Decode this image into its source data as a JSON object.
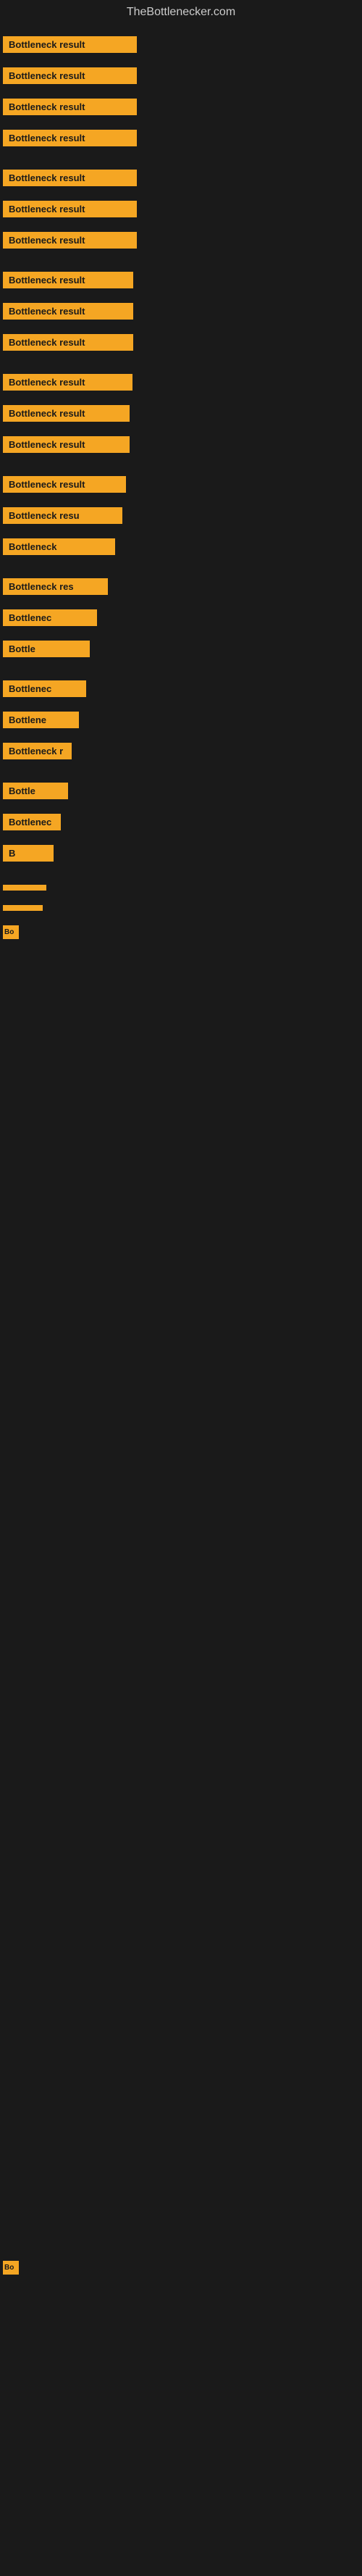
{
  "site": {
    "title": "TheBottlenecker.com"
  },
  "items": [
    {
      "id": 0,
      "label": "Bottleneck result"
    },
    {
      "id": 1,
      "label": "Bottleneck result"
    },
    {
      "id": 2,
      "label": "Bottleneck result"
    },
    {
      "id": 3,
      "label": "Bottleneck result"
    },
    {
      "id": 4,
      "label": "Bottleneck result"
    },
    {
      "id": 5,
      "label": "Bottleneck result"
    },
    {
      "id": 6,
      "label": "Bottleneck result"
    },
    {
      "id": 7,
      "label": "Bottleneck result"
    },
    {
      "id": 8,
      "label": "Bottleneck result"
    },
    {
      "id": 9,
      "label": "Bottleneck result"
    },
    {
      "id": 10,
      "label": "Bottleneck result"
    },
    {
      "id": 11,
      "label": "Bottleneck result"
    },
    {
      "id": 12,
      "label": "Bottleneck result"
    },
    {
      "id": 13,
      "label": "Bottleneck result"
    },
    {
      "id": 14,
      "label": "Bottleneck resu"
    },
    {
      "id": 15,
      "label": "Bottleneck"
    },
    {
      "id": 16,
      "label": "Bottleneck res"
    },
    {
      "id": 17,
      "label": "Bottlenec"
    },
    {
      "id": 18,
      "label": "Bottle"
    },
    {
      "id": 19,
      "label": "Bottlenec"
    },
    {
      "id": 20,
      "label": "Bottlene"
    },
    {
      "id": 21,
      "label": "Bottleneck r"
    },
    {
      "id": 22,
      "label": "Bottle"
    },
    {
      "id": 23,
      "label": "Bottlenec"
    },
    {
      "id": 24,
      "label": "B"
    },
    {
      "id": 25,
      "label": ""
    },
    {
      "id": 26,
      "label": ""
    },
    {
      "id": 27,
      "label": "Bo"
    }
  ]
}
